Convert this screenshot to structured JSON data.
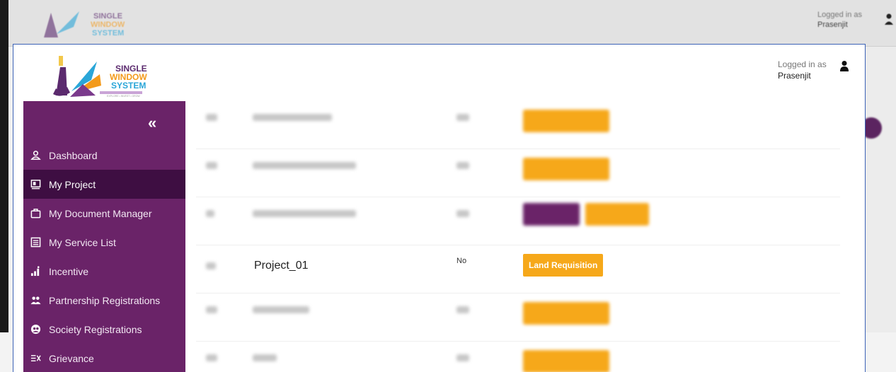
{
  "app": {
    "logo_line1": "SINGLE",
    "logo_line2": "WINDOW",
    "logo_line3": "SYSTEM",
    "logo_tagline": "EXPLORE • INVEST • GROW"
  },
  "header": {
    "logged_in_label": "Logged in as",
    "username": "Prasenjit"
  },
  "sidebar": {
    "collapse_icon": "double-chevron-left-icon",
    "items": [
      {
        "label": "Dashboard",
        "icon": "user-icon"
      },
      {
        "label": "My Project",
        "icon": "project-icon"
      },
      {
        "label": "My Document Manager",
        "icon": "briefcase-icon"
      },
      {
        "label": "My Service List",
        "icon": "list-icon"
      },
      {
        "label": "Incentive",
        "icon": "chart-icon"
      },
      {
        "label": "Partnership Registrations",
        "icon": "users-icon"
      },
      {
        "label": "Society Registrations",
        "icon": "society-icon"
      },
      {
        "label": "Grievance",
        "icon": "grievance-icon"
      }
    ]
  },
  "table": {
    "visible_row": {
      "name": "Project_01",
      "flag": "No",
      "action": "Land Requisition"
    }
  },
  "colors": {
    "sidebar": "#6a2368",
    "sidebar_active": "#3e0e42",
    "action_button": "#f6a81a",
    "secondary_button": "#6a2368",
    "window_border": "#3b62b6"
  }
}
